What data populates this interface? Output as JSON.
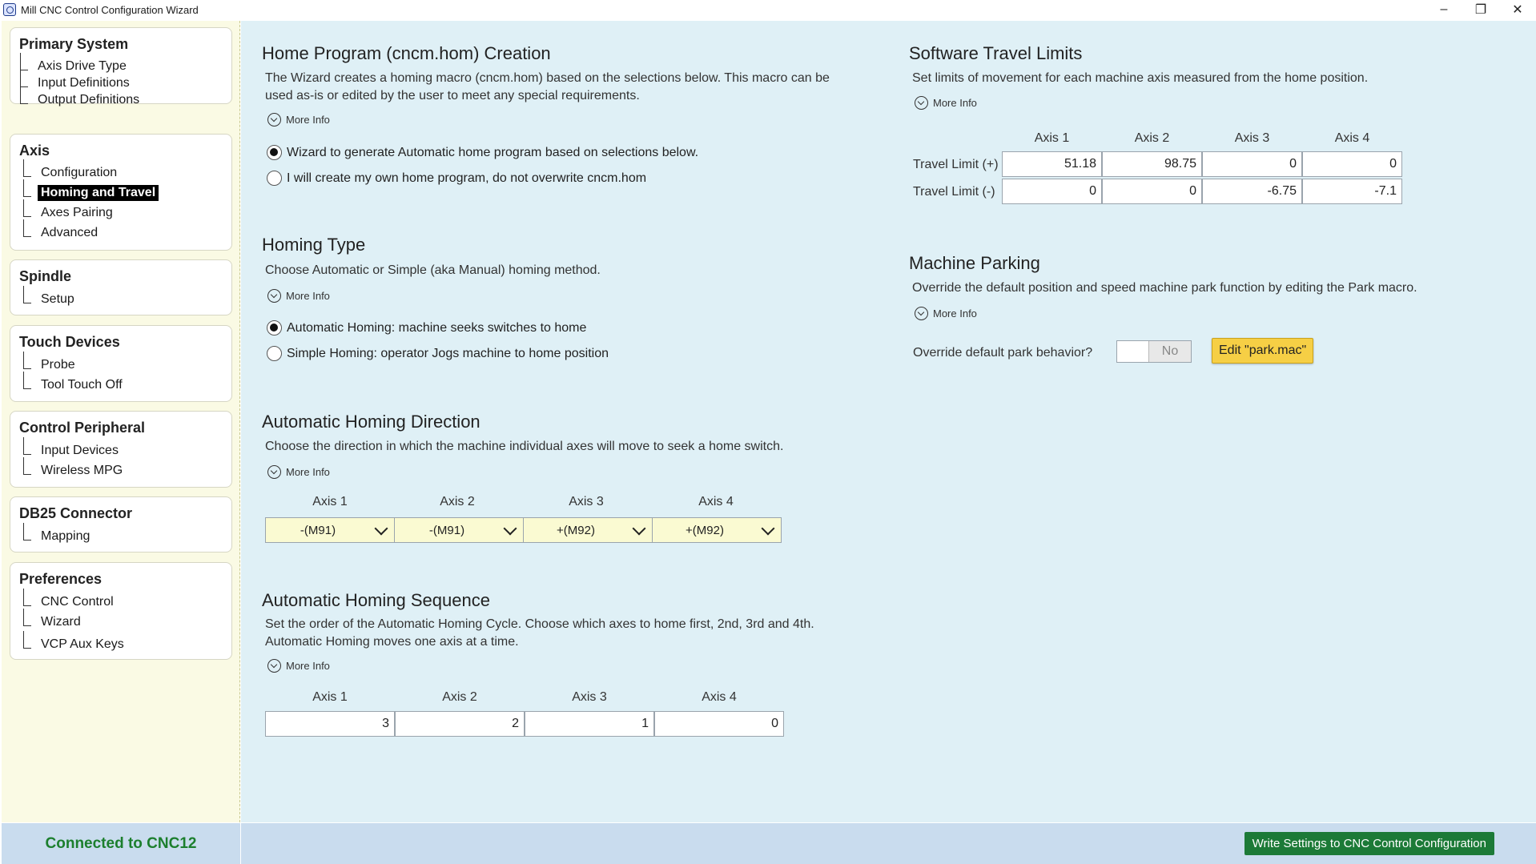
{
  "window": {
    "title": "Mill CNC Control Configuration Wizard"
  },
  "sidebar": {
    "groups": [
      {
        "title": "Primary System",
        "items": [
          "Axis Drive Type",
          "Input Definitions",
          "Output Definitions"
        ]
      },
      {
        "title": "Axis",
        "items": [
          "Configuration",
          "Homing and Travel",
          "Axes Pairing",
          "Advanced"
        ],
        "active_index": 1
      },
      {
        "title": "Spindle",
        "items": [
          "Setup"
        ]
      },
      {
        "title": "Touch Devices",
        "items": [
          "Probe",
          "Tool Touch Off"
        ]
      },
      {
        "title": "Control Peripheral",
        "items": [
          "Input Devices",
          "Wireless MPG"
        ]
      },
      {
        "title": "DB25 Connector",
        "items": [
          "Mapping"
        ]
      },
      {
        "title": "Preferences",
        "items": [
          "CNC Control",
          "Wizard",
          "VCP Aux Keys"
        ]
      }
    ]
  },
  "more_info": "More Info",
  "home_program": {
    "title": "Home Program (cncm.hom) Creation",
    "desc_line1": "The Wizard creates a homing macro (cncm.hom) based on the selections below.  This macro can be",
    "desc_line2": "used as-is or edited by the user to meet any special requirements.",
    "options": [
      "Wizard to generate Automatic home program based on selections below.",
      "I will create my own home program, do not overwrite cncm.hom"
    ],
    "selected": 0
  },
  "homing_type": {
    "title": "Homing Type",
    "desc": "Choose Automatic or Simple (aka Manual) homing method.",
    "options": [
      "Automatic Homing: machine seeks switches to home",
      "Simple Homing: operator Jogs machine to home position"
    ],
    "selected": 0
  },
  "homing_direction": {
    "title": "Automatic Homing Direction",
    "desc": "Choose the direction in which the machine individual axes will move to seek a home switch.",
    "axes": [
      "Axis 1",
      "Axis 2",
      "Axis 3",
      "Axis 4"
    ],
    "values": [
      "-(M91)",
      "-(M91)",
      "+(M92)",
      "+(M92)"
    ]
  },
  "homing_sequence": {
    "title": "Automatic Homing Sequence",
    "desc_line1": "Set the order of the Automatic Homing Cycle.  Choose which axes to home first, 2nd, 3rd and 4th.",
    "desc_line2": "Automatic Homing moves one axis at a time.",
    "axes": [
      "Axis 1",
      "Axis 2",
      "Axis 3",
      "Axis 4"
    ],
    "values": [
      "3",
      "2",
      "1",
      "0"
    ]
  },
  "travel_limits": {
    "title": "Software Travel Limits",
    "desc": "Set limits of movement for each machine axis measured from the home position.",
    "axes": [
      "Axis 1",
      "Axis 2",
      "Axis 3",
      "Axis 4"
    ],
    "rows": [
      {
        "label": "Travel Limit (+)",
        "values": [
          "51.18",
          "98.75",
          "0",
          "0"
        ]
      },
      {
        "label": "Travel Limit (-)",
        "values": [
          "0",
          "0",
          "-6.75",
          "-7.1"
        ]
      }
    ]
  },
  "parking": {
    "title": "Machine Parking",
    "desc": "Override the default position and speed machine park function by editing the Park macro.",
    "override_label": "Override default park behavior?",
    "toggle_value": "No",
    "edit_button": "Edit \"park.mac\""
  },
  "status": {
    "connection": "Connected to CNC12",
    "write_button": "Write Settings to CNC Control Configuration",
    "connection_color": "#1c7f2e",
    "button_color": "#1c7a37"
  }
}
